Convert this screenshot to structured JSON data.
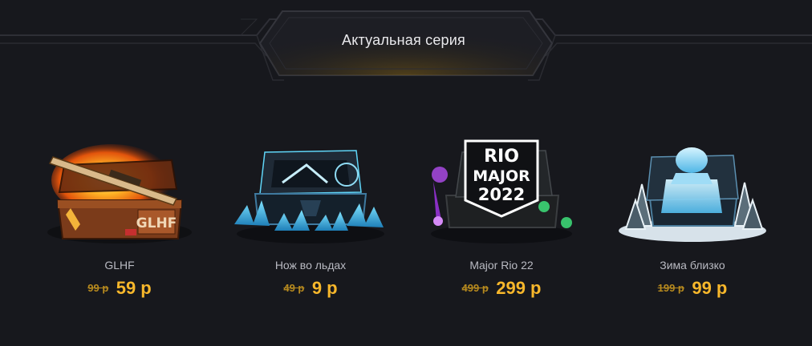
{
  "section": {
    "title": "Актуальная серия"
  },
  "cases": [
    {
      "name": "GLHF",
      "old_price": "99 р",
      "price": "59 р",
      "art_text": "GLHF"
    },
    {
      "name": "Нож во льдах",
      "old_price": "49 р",
      "price": "9 р"
    },
    {
      "name": "Major Rio 22",
      "old_price": "499 р",
      "price": "299 р",
      "art_text_1": "RIO",
      "art_text_2": "MAJOR",
      "art_text_3": "2022"
    },
    {
      "name": "Зима близко",
      "old_price": "199 р",
      "price": "99 р"
    }
  ],
  "colors": {
    "background": "#17181d",
    "accent_gold": "#f7b72b",
    "old_price": "#b78a1e",
    "text": "#b9bac2"
  }
}
